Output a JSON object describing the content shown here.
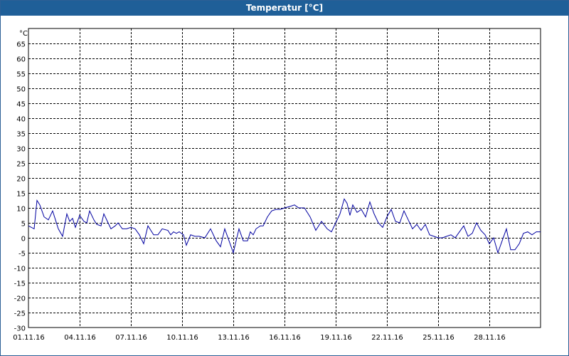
{
  "window": {
    "title": "Temperatur [°C]"
  },
  "colors": {
    "titlebar": "#1f5f98",
    "line": "#0000a0",
    "grid": "#000000"
  },
  "chart_data": {
    "type": "line",
    "title": "Temperatur [°C]",
    "ylabel": "°C",
    "xlabel": "",
    "ylim": [
      -30,
      70
    ],
    "yticks": [
      65,
      60,
      55,
      50,
      45,
      40,
      35,
      30,
      25,
      20,
      15,
      10,
      5,
      0,
      -5,
      -10,
      -15,
      -20,
      -25,
      -30
    ],
    "xlim": [
      "2016-11-01",
      "2016-12-01"
    ],
    "xticks": [
      "01.11.16",
      "04.11.16",
      "07.11.16",
      "10.11.16",
      "13.11.16",
      "16.11.16",
      "19.11.16",
      "22.11.16",
      "25.11.16",
      "28.11.16"
    ],
    "grid": true,
    "series": [
      {
        "x": [
          "2016-11-01 00:00",
          "2016-11-01 08:00",
          "2016-11-01 12:00",
          "2016-11-01 16:00",
          "2016-11-01 22:00",
          "2016-11-02 04:00",
          "2016-11-02 10:00",
          "2016-11-02 14:00",
          "2016-11-02 18:00",
          "2016-11-03 00:00",
          "2016-11-03 06:00",
          "2016-11-03 10:00",
          "2016-11-03 14:00",
          "2016-11-03 18:00",
          "2016-11-04 00:00",
          "2016-11-04 06:00",
          "2016-11-04 10:00",
          "2016-11-04 14:00",
          "2016-11-04 20:00",
          "2016-11-05 00:00",
          "2016-11-05 06:00",
          "2016-11-05 10:00",
          "2016-11-05 16:00",
          "2016-11-05 20:00",
          "2016-11-06 02:00",
          "2016-11-06 06:00",
          "2016-11-06 12:00",
          "2016-11-06 18:00",
          "2016-11-07 00:00",
          "2016-11-07 06:00",
          "2016-11-07 12:00",
          "2016-11-07 18:00",
          "2016-11-08 00:00",
          "2016-11-08 08:00",
          "2016-11-08 14:00",
          "2016-11-08 20:00",
          "2016-11-09 04:00",
          "2016-11-09 08:00",
          "2016-11-09 12:00",
          "2016-11-09 16:00",
          "2016-11-09 20:00",
          "2016-11-10 02:00",
          "2016-11-10 06:00",
          "2016-11-10 12:00",
          "2016-11-10 18:00",
          "2016-11-11 00:00",
          "2016-11-11 08:00",
          "2016-11-11 16:00",
          "2016-11-12 00:00",
          "2016-11-12 06:00",
          "2016-11-12 12:00",
          "2016-11-12 18:00",
          "2016-11-13 00:00",
          "2016-11-13 08:00",
          "2016-11-13 14:00",
          "2016-11-13 20:00",
          "2016-11-14 00:00",
          "2016-11-14 04:00",
          "2016-11-14 08:00",
          "2016-11-14 14:00",
          "2016-11-14 18:00",
          "2016-11-15 00:00",
          "2016-11-15 06:00",
          "2016-11-15 12:00",
          "2016-11-15 18:00",
          "2016-11-16 00:00",
          "2016-11-16 08:00",
          "2016-11-16 14:00",
          "2016-11-16 20:00",
          "2016-11-17 04:00",
          "2016-11-17 12:00",
          "2016-11-17 20:00",
          "2016-11-18 04:00",
          "2016-11-18 12:00",
          "2016-11-18 18:00",
          "2016-11-19 00:00",
          "2016-11-19 06:00",
          "2016-11-19 12:00",
          "2016-11-19 16:00",
          "2016-11-19 20:00",
          "2016-11-20 00:00",
          "2016-11-20 06:00",
          "2016-11-20 12:00",
          "2016-11-20 18:00",
          "2016-11-21 00:00",
          "2016-11-21 06:00",
          "2016-11-21 12:00",
          "2016-11-21 18:00",
          "2016-11-22 00:00",
          "2016-11-22 06:00",
          "2016-11-22 12:00",
          "2016-11-22 18:00",
          "2016-11-23 00:00",
          "2016-11-23 06:00",
          "2016-11-23 12:00",
          "2016-11-23 18:00",
          "2016-11-24 00:00",
          "2016-11-24 06:00",
          "2016-11-24 12:00",
          "2016-11-24 18:00",
          "2016-11-25 00:00",
          "2016-11-25 06:00",
          "2016-11-25 12:00",
          "2016-11-25 18:00",
          "2016-11-26 00:00",
          "2016-11-26 06:00",
          "2016-11-26 12:00",
          "2016-11-26 18:00",
          "2016-11-27 00:00",
          "2016-11-27 06:00",
          "2016-11-27 12:00",
          "2016-11-27 18:00",
          "2016-11-28 00:00",
          "2016-11-28 06:00",
          "2016-11-28 12:00",
          "2016-11-28 18:00",
          "2016-11-29 00:00",
          "2016-11-29 06:00",
          "2016-11-29 12:00",
          "2016-11-29 18:00",
          "2016-11-30 00:00",
          "2016-11-30 06:00",
          "2016-11-30 12:00",
          "2016-11-30 18:00",
          "2016-12-01 00:00"
        ],
        "y": [
          4,
          3,
          12.5,
          11,
          7,
          6,
          9,
          6,
          3,
          0.5,
          8,
          5.5,
          6.5,
          3.5,
          7.5,
          5.5,
          5,
          9,
          6,
          4.5,
          4,
          8,
          5,
          3,
          4,
          5,
          3,
          3,
          3.5,
          3,
          1,
          -2,
          4,
          1,
          1,
          3,
          2.5,
          1,
          2,
          1.5,
          2,
          1,
          -2.5,
          1,
          0.5,
          0.5,
          0,
          3,
          -1,
          -3,
          3,
          -1,
          -5,
          3,
          -1,
          -1,
          2,
          1,
          3,
          4,
          4,
          7,
          9,
          9.5,
          9.5,
          10,
          10.5,
          11,
          10,
          10,
          7,
          2.5,
          5.5,
          3,
          2,
          5,
          8,
          13,
          11.5,
          7.5,
          11,
          8.5,
          9.5,
          7,
          12,
          8,
          5,
          3.5,
          7,
          9.5,
          5.5,
          5,
          9,
          6,
          3,
          4.5,
          2.5,
          4.5,
          1,
          0.5,
          0,
          0,
          0.5,
          1,
          0,
          2,
          4,
          0.5,
          1.5,
          5,
          2.5,
          1,
          -2,
          0,
          -5,
          -1,
          3,
          -4,
          -4,
          -2,
          1.5,
          2,
          1,
          2,
          2
        ]
      }
    ]
  }
}
